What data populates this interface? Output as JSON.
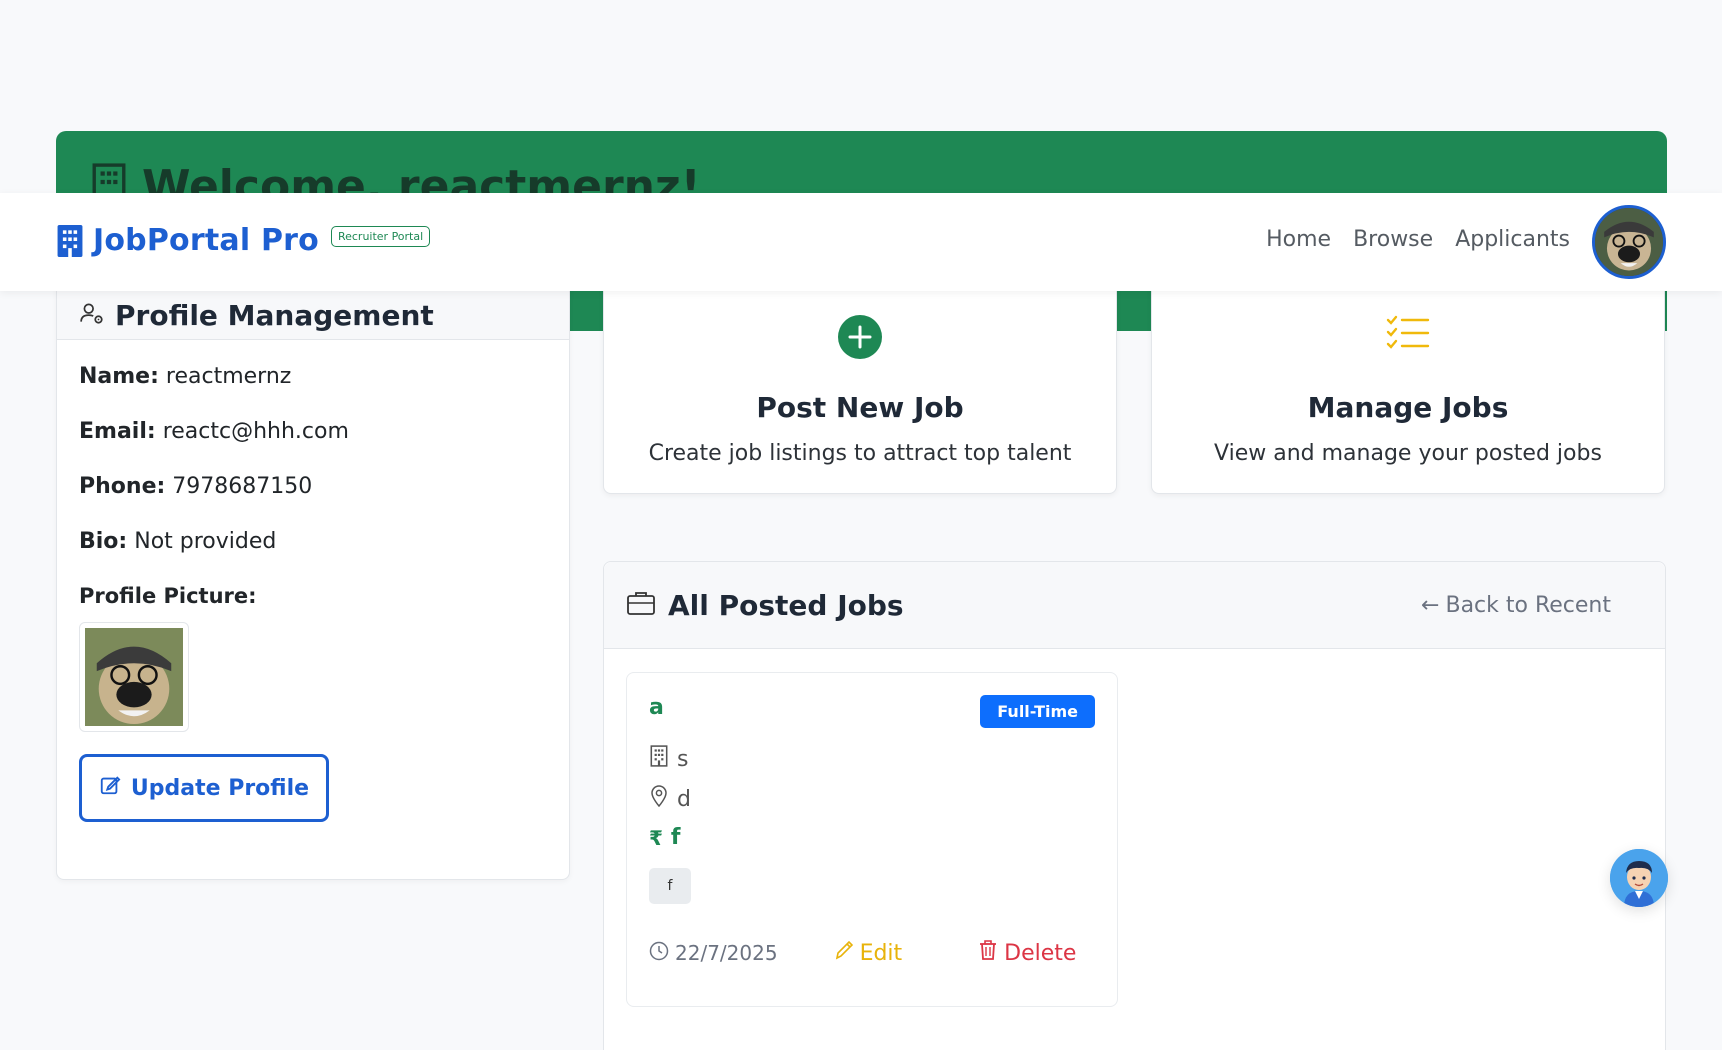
{
  "welcome": {
    "title": "Welcome, reactmernz!"
  },
  "navbar": {
    "brand": "JobPortal Pro",
    "badge": "Recruiter Portal",
    "links": [
      "Home",
      "Browse",
      "Applicants"
    ]
  },
  "profile": {
    "header": "Profile Management",
    "name_label": "Name:",
    "name": "reactmernz",
    "email_label": "Email:",
    "email": "reactc@hhh.com",
    "phone_label": "Phone:",
    "phone": "7978687150",
    "bio_label": "Bio:",
    "bio": "Not provided",
    "picture_label": "Profile Picture:",
    "update_button": "Update Profile"
  },
  "actions": {
    "post": {
      "title": "Post New Job",
      "desc": "Create job listings to attract top talent"
    },
    "manage": {
      "title": "Manage Jobs",
      "desc": "View and manage your posted jobs"
    }
  },
  "jobs": {
    "header": "All Posted Jobs",
    "back_link": "Back to Recent",
    "items": [
      {
        "title": "a",
        "type": "Full-Time",
        "company": "s",
        "location": "d",
        "salary": "f",
        "tag": "f",
        "date": "22/7/2025",
        "edit": "Edit",
        "delete": "Delete"
      }
    ]
  },
  "colors": {
    "brand_blue": "#1d5fd1",
    "green": "#1e8854",
    "badge_blue": "#0d6efd",
    "edit_yellow": "#e8b30a",
    "delete_red": "#dc3545"
  }
}
